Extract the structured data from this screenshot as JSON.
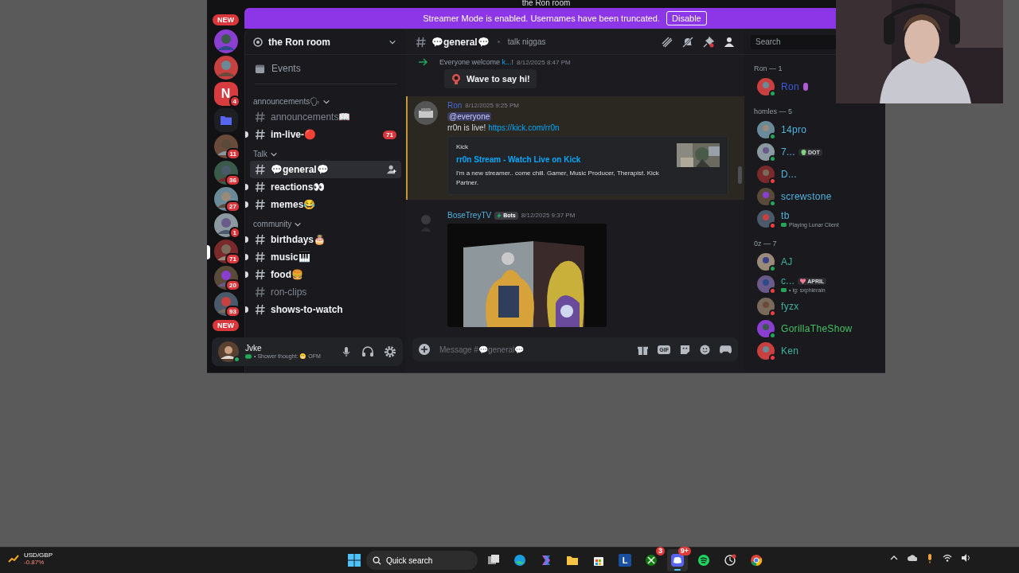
{
  "window": {
    "title": "the Ron room"
  },
  "banner": {
    "text": "Streamer Mode is enabled. Usernames have been truncated.",
    "button": "Disable"
  },
  "servers": [
    {
      "kind": "new",
      "label": "NEW",
      "selected": false
    },
    {
      "kind": "icon",
      "selected": false
    },
    {
      "kind": "icon",
      "selected": false
    },
    {
      "kind": "letter",
      "label": "N",
      "badge": "4",
      "selected": false
    },
    {
      "kind": "folder",
      "selected": false
    },
    {
      "kind": "icon",
      "badge": "11",
      "selected": false
    },
    {
      "kind": "icon",
      "badge": "36",
      "selected": false
    },
    {
      "kind": "icon",
      "badge": "27",
      "selected": false
    },
    {
      "kind": "icon",
      "badge": "1",
      "selected": false
    },
    {
      "kind": "icon",
      "badge": "71",
      "selected": true
    },
    {
      "kind": "icon",
      "badge": "20",
      "selected": false
    },
    {
      "kind": "icon",
      "badge": "93",
      "selected": false
    },
    {
      "kind": "new",
      "label": "NEW",
      "selected": false
    }
  ],
  "channel_sidebar": {
    "server_name": "the Ron room",
    "events": "Events",
    "categories": [
      {
        "name": "announcements🗣",
        "channels": [
          {
            "name": "announcements📖",
            "unread": false,
            "selected": false
          },
          {
            "name": "im-live-🔴",
            "unread": true,
            "selected": false,
            "badge": "71"
          }
        ]
      },
      {
        "name": "Talk",
        "channels": [
          {
            "name": "💬general💬",
            "unread": true,
            "selected": true
          },
          {
            "name": "reactions👀",
            "unread": true,
            "selected": false
          },
          {
            "name": "memes😂",
            "unread": true,
            "selected": false
          }
        ]
      },
      {
        "name": "community",
        "channels": [
          {
            "name": "birthdays🎂",
            "unread": true,
            "selected": false
          },
          {
            "name": "music🎹",
            "unread": true,
            "selected": false
          },
          {
            "name": "food🍔",
            "unread": true,
            "selected": false
          },
          {
            "name": "ron-clips",
            "unread": false,
            "selected": false
          },
          {
            "name": "shows-to-watch",
            "unread": true,
            "selected": false
          }
        ]
      }
    ]
  },
  "user_panel": {
    "name": "Jvke",
    "status": "• Shower thought: 😬 OFM"
  },
  "chat": {
    "channel": "💬general💬",
    "topic": "talk niggas",
    "search": {
      "placeholder": "Search"
    },
    "messages": [
      {
        "kind": "join",
        "text": "Everyone welcome ",
        "user": "k...",
        "after": "!",
        "time": "8/12/2025 8:47 PM",
        "button": "Wave to say hi!"
      },
      {
        "kind": "message",
        "author": "Ron",
        "time": "8/12/2025 9:25 PM",
        "mention": "@everyone",
        "text": "rr0n is live! ",
        "link": "https://kick.com/rr0n",
        "embed": {
          "provider": "Kick",
          "title": "rr0n Stream - Watch Live on Kick",
          "description": "I'm a new streamer.. come chill. Gamer, Music Producer, Therapist. Kick Partner."
        }
      },
      {
        "kind": "bot",
        "author": "BoseTreyTV",
        "tag": "Bots",
        "time": "8/12/2025 9:37 PM"
      }
    ],
    "composer": {
      "placeholder": "Message #💬general💬",
      "gif": "GIF"
    }
  },
  "member_list": {
    "groups": [
      {
        "title": "Ron — 1",
        "members": [
          {
            "name": "Ron",
            "dnd": false,
            "color": "#3b5bdb",
            "badge": true
          }
        ]
      },
      {
        "title": "homles — 5",
        "members": [
          {
            "name": "14pro",
            "dnd": false,
            "color": "#4fb3e0"
          },
          {
            "name": "7...",
            "dnd": false,
            "color": "#4fb3e0",
            "tag": "DOT"
          },
          {
            "name": "D...",
            "dnd": true,
            "color": "#4fb3e0"
          },
          {
            "name": "screwstone",
            "dnd": false,
            "color": "#4fb3e0"
          },
          {
            "name": "tb",
            "dnd": true,
            "color": "#4fb3e0",
            "activity": "Playing Lunar Client"
          }
        ]
      },
      {
        "title": "0z — 7",
        "members": [
          {
            "name": "AJ",
            "dnd": false,
            "color": "#3fb0a0"
          },
          {
            "name": "c...",
            "dnd": true,
            "color": "#3fb0a0",
            "tag": "APRIL",
            "activity": "• ig: sxphierain"
          },
          {
            "name": "fyzx",
            "dnd": true,
            "color": "#3fb0a0"
          },
          {
            "name": "GorillaTheShow",
            "dnd": false,
            "color": "#43c063"
          },
          {
            "name": "Ken",
            "dnd": true,
            "color": "#3fb0a0"
          }
        ]
      }
    ]
  },
  "taskbar": {
    "widget": {
      "title": "USD/GBP",
      "change": "-0.87%"
    },
    "search": "Quick search",
    "apps": [
      {
        "kind": "taskview",
        "selected": false
      },
      {
        "kind": "edge",
        "selected": false
      },
      {
        "kind": "copilot",
        "selected": false
      },
      {
        "kind": "explorer",
        "selected": false
      },
      {
        "kind": "store",
        "selected": false
      },
      {
        "kind": "letter",
        "label": "L",
        "selected": false
      },
      {
        "kind": "xbox",
        "badge": "3",
        "selected": false
      },
      {
        "kind": "discord",
        "badge": "9+",
        "selected": true
      },
      {
        "kind": "spotify",
        "selected": false
      },
      {
        "kind": "clock",
        "selected": false
      },
      {
        "kind": "chrome",
        "selected": false
      }
    ]
  }
}
